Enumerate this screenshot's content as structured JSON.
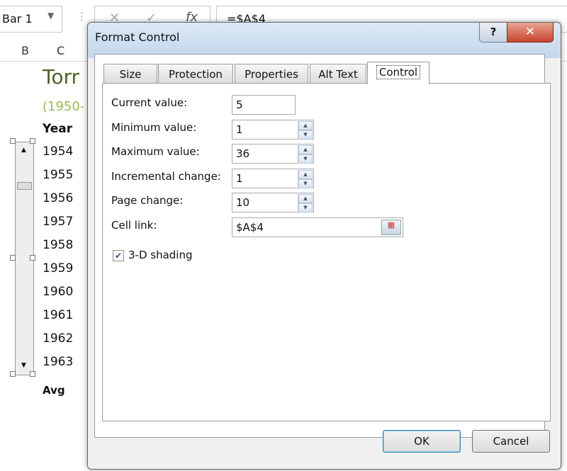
{
  "excel": {
    "name_box": "Bar 1",
    "formula": "=$A$4",
    "cancel_icon": "✕",
    "enter_icon": "✓",
    "fx_icon": "fx",
    "columns": [
      "B",
      "C"
    ],
    "title": "Torr",
    "subtitle": "(1950-",
    "year_header": "Year",
    "years": [
      "1954",
      "1955",
      "1956",
      "1957",
      "1958",
      "1959",
      "1960",
      "1961",
      "1962",
      "1963"
    ],
    "avg_label": "Avg"
  },
  "dialog": {
    "title": "Format Control",
    "help": "?",
    "close": "✕",
    "tabs": [
      {
        "label": "Size"
      },
      {
        "label": "Protection"
      },
      {
        "label": "Properties"
      },
      {
        "label": "Alt Text"
      },
      {
        "label": "Control"
      }
    ],
    "active_tab": "Control",
    "fields": [
      {
        "label": "Current value:",
        "value": "5"
      },
      {
        "label": "Minimum value:",
        "value": "1"
      },
      {
        "label": "Maximum value:",
        "value": "36"
      },
      {
        "label": "Incremental change:",
        "value": "1"
      },
      {
        "label": "Page change:",
        "value": "10"
      },
      {
        "label": "Cell link:",
        "value": "$A$4"
      }
    ],
    "shading_label": "3-D shading",
    "shading_checked": true,
    "ok": "OK",
    "cancel": "Cancel"
  }
}
